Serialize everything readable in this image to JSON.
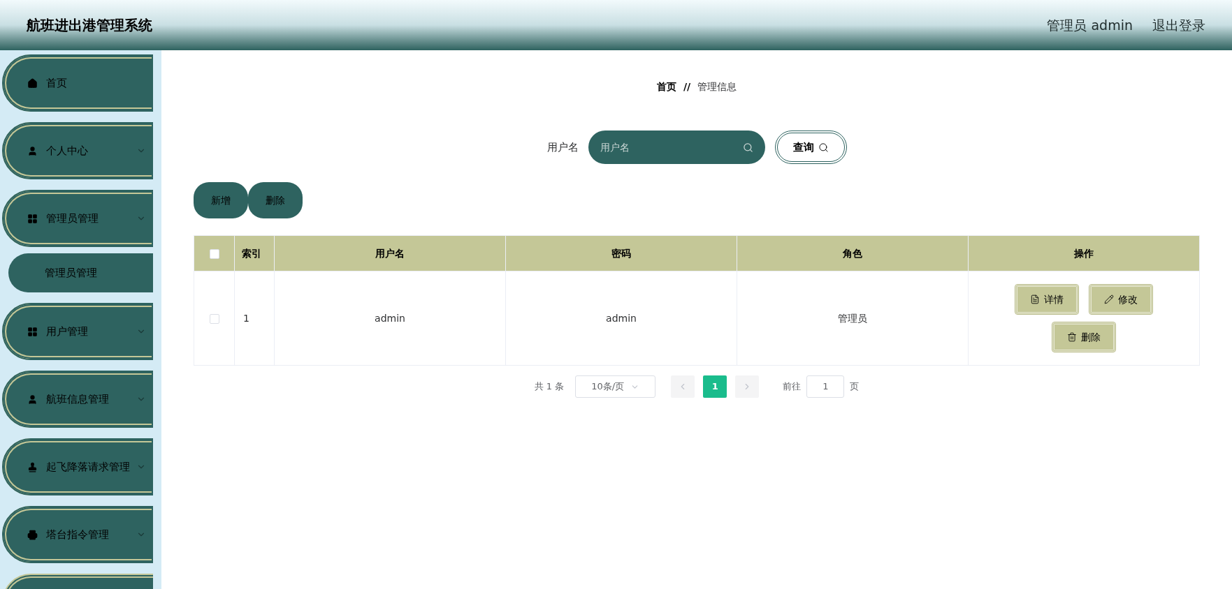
{
  "header": {
    "title": "航班进出港管理系统",
    "user": "管理员 admin",
    "logout": "退出登录"
  },
  "sidebar": {
    "items": [
      {
        "label": "首页",
        "has_arrow": false
      },
      {
        "label": "个人中心",
        "has_arrow": true
      },
      {
        "label": "管理员管理",
        "has_arrow": true,
        "children": [
          {
            "label": "管理员管理"
          }
        ]
      },
      {
        "label": "用户管理",
        "has_arrow": true
      },
      {
        "label": "航班信息管理",
        "has_arrow": true
      },
      {
        "label": "起飞降落请求管理",
        "has_arrow": true
      },
      {
        "label": "塔台指令管理",
        "has_arrow": true
      }
    ]
  },
  "breadcrumb": [
    "首页",
    "管理信息"
  ],
  "breadcrumb_separator": "//",
  "search": {
    "label": "用户名",
    "placeholder": "用户名",
    "button": "查询"
  },
  "actions": [
    "新增",
    "删除"
  ],
  "table": {
    "select_all_checked": false,
    "columns": [
      "索引",
      "用户名",
      "密码",
      "角色",
      "操作"
    ],
    "rows": [
      {
        "checked": false,
        "cells": [
          "1",
          "admin",
          "admin",
          "管理员"
        ],
        "buttons": [
          "详情",
          "修改",
          "删除"
        ]
      }
    ]
  },
  "pagination": {
    "total": "共 1 条",
    "page_size": "10条/页",
    "pages": [
      {
        "label": "1",
        "selected": true
      }
    ],
    "goto_label": "前往",
    "goto_value": "1",
    "goto_suffix": "页"
  }
}
